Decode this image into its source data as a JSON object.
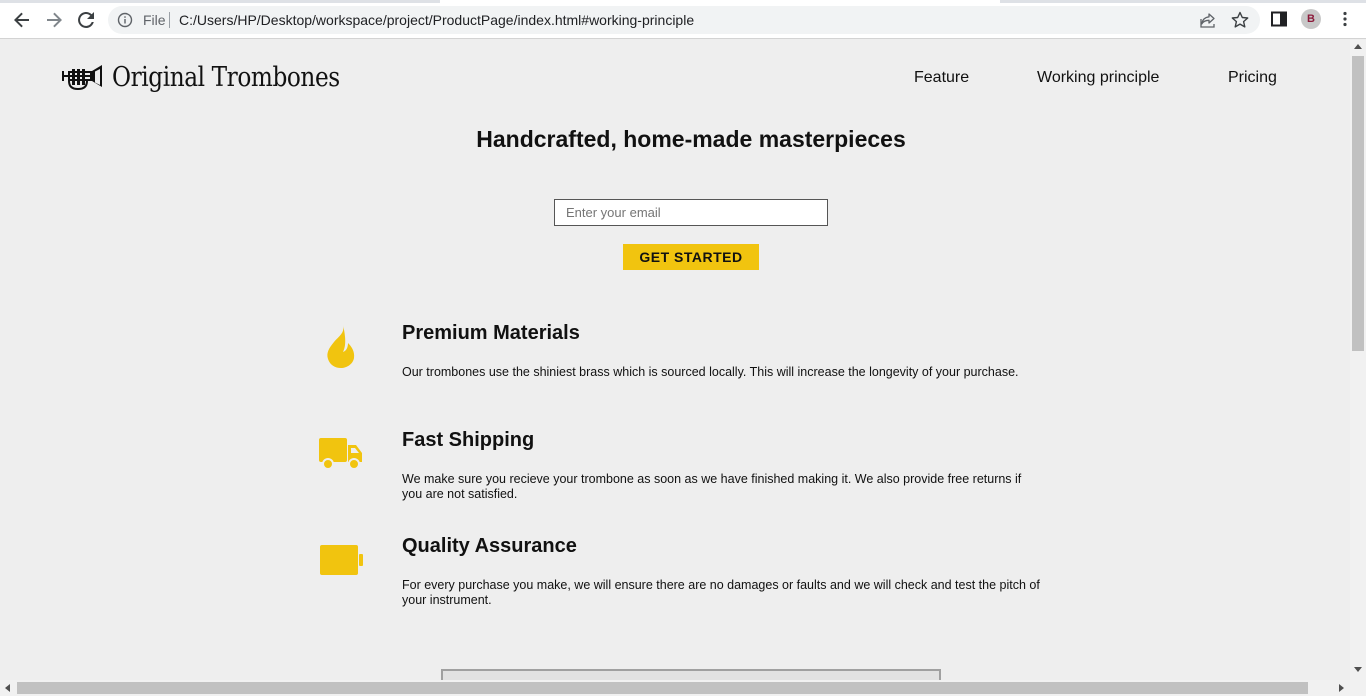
{
  "browser": {
    "scheme_label": "File",
    "url": "C:/Users/HP/Desktop/workspace/project/ProductPage/index.html#working-principle",
    "profile_initial": "B"
  },
  "header": {
    "logo_text": "Original Trombones",
    "nav": [
      {
        "label": "Feature"
      },
      {
        "label": "Working principle"
      },
      {
        "label": "Pricing"
      }
    ]
  },
  "hero": {
    "title": "Handcrafted, home-made masterpieces",
    "email_placeholder": "Enter your email",
    "cta_label": "GET STARTED"
  },
  "features": [
    {
      "icon": "fire-icon",
      "title": "Premium Materials",
      "description": "Our trombones use the shiniest brass which is sourced locally. This will increase the longevity of your purchase."
    },
    {
      "icon": "truck-icon",
      "title": "Fast Shipping",
      "description": "We make sure you recieve your trombone as soon as we have finished making it. We also provide free returns if you are not satisfied."
    },
    {
      "icon": "battery-icon",
      "title": "Quality Assurance",
      "description": "For every purchase you make, we will ensure there are no damages or faults and we will check and test the pitch of your instrument."
    }
  ],
  "colors": {
    "accent": "#f1c40f",
    "page_background": "#eeeeee",
    "text": "#111111"
  }
}
